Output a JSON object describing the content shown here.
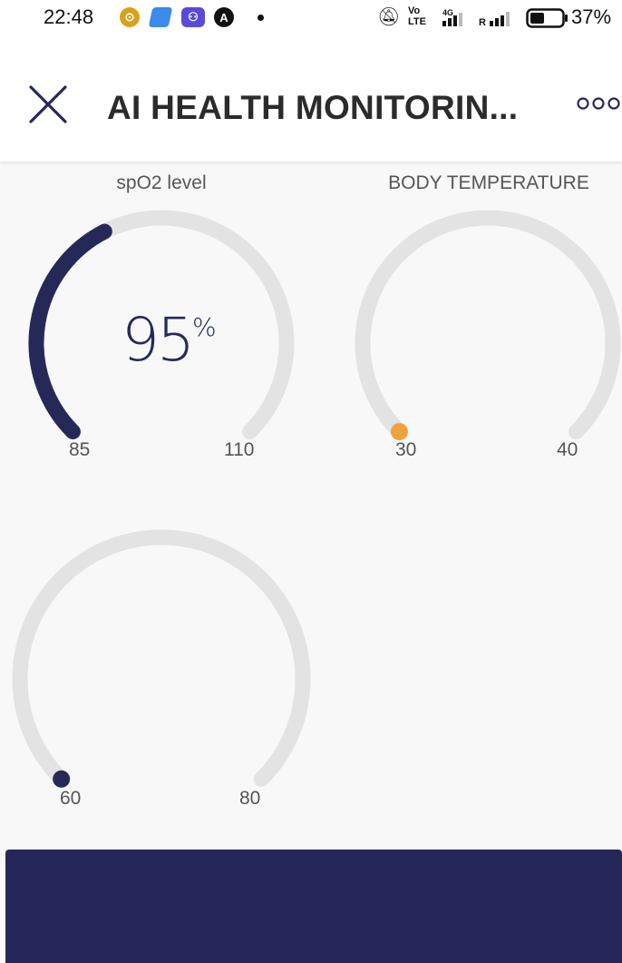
{
  "status_bar": {
    "time": "22:48",
    "battery": "37%"
  },
  "app_bar": {
    "title": "AI HEALTH MONITORIN..."
  },
  "gauges": [
    {
      "label": "spO2 level",
      "value": "95",
      "unit": "%",
      "min": "85",
      "max": "110",
      "fill_fraction": 0.4,
      "color": "#262958"
    },
    {
      "label": "BODY TEMPERATURE",
      "min": "30",
      "max": "40",
      "fill_fraction": 0,
      "color": "#f0a33c"
    },
    {
      "min": "60",
      "max": "80",
      "fill_fraction": 0,
      "color": "#262958"
    }
  ],
  "colors": {
    "track": "#e3e3e3",
    "bottom_bar": "#262758"
  }
}
